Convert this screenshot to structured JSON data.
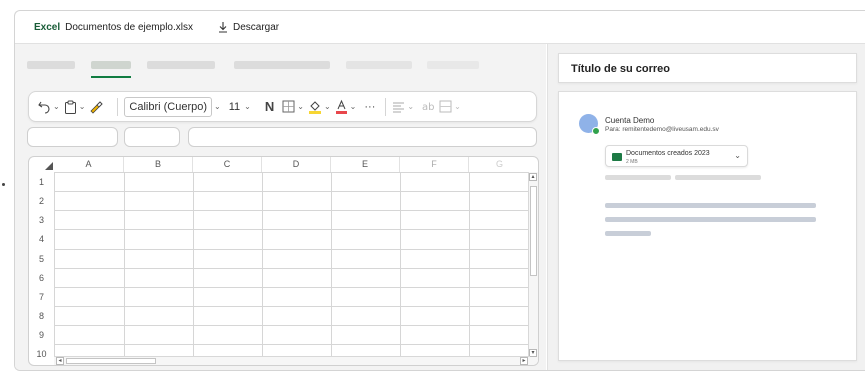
{
  "topbar": {
    "app_name": "Excel",
    "file_name": "Documentos de ejemplo.xlsx",
    "download_label": "Descargar"
  },
  "ribbon": {
    "font_name": "Calibri (Cuerpo)",
    "font_size": "11",
    "bold_label": "N",
    "more_label": "···",
    "font_color_accent": "#e8474c",
    "fill_color_accent": "#f7d633"
  },
  "sheet": {
    "columns": [
      "A",
      "B",
      "C",
      "D",
      "E",
      "F",
      "G"
    ],
    "rows": [
      "1",
      "2",
      "3",
      "4",
      "5",
      "6",
      "7",
      "8",
      "9",
      "10"
    ]
  },
  "mail": {
    "subject_placeholder": "Título de su correo",
    "sender_name": "Cuenta Demo",
    "to_label": "Para:",
    "to_address": "remitentedemo@liveusam.edu.sv",
    "attachment_name": "Documentos creados 2023",
    "attachment_size": "2 MB"
  },
  "colors": {
    "excel_green": "#107c41",
    "avatar_blue": "#8fb2e8",
    "presence_green": "#31a24c"
  }
}
